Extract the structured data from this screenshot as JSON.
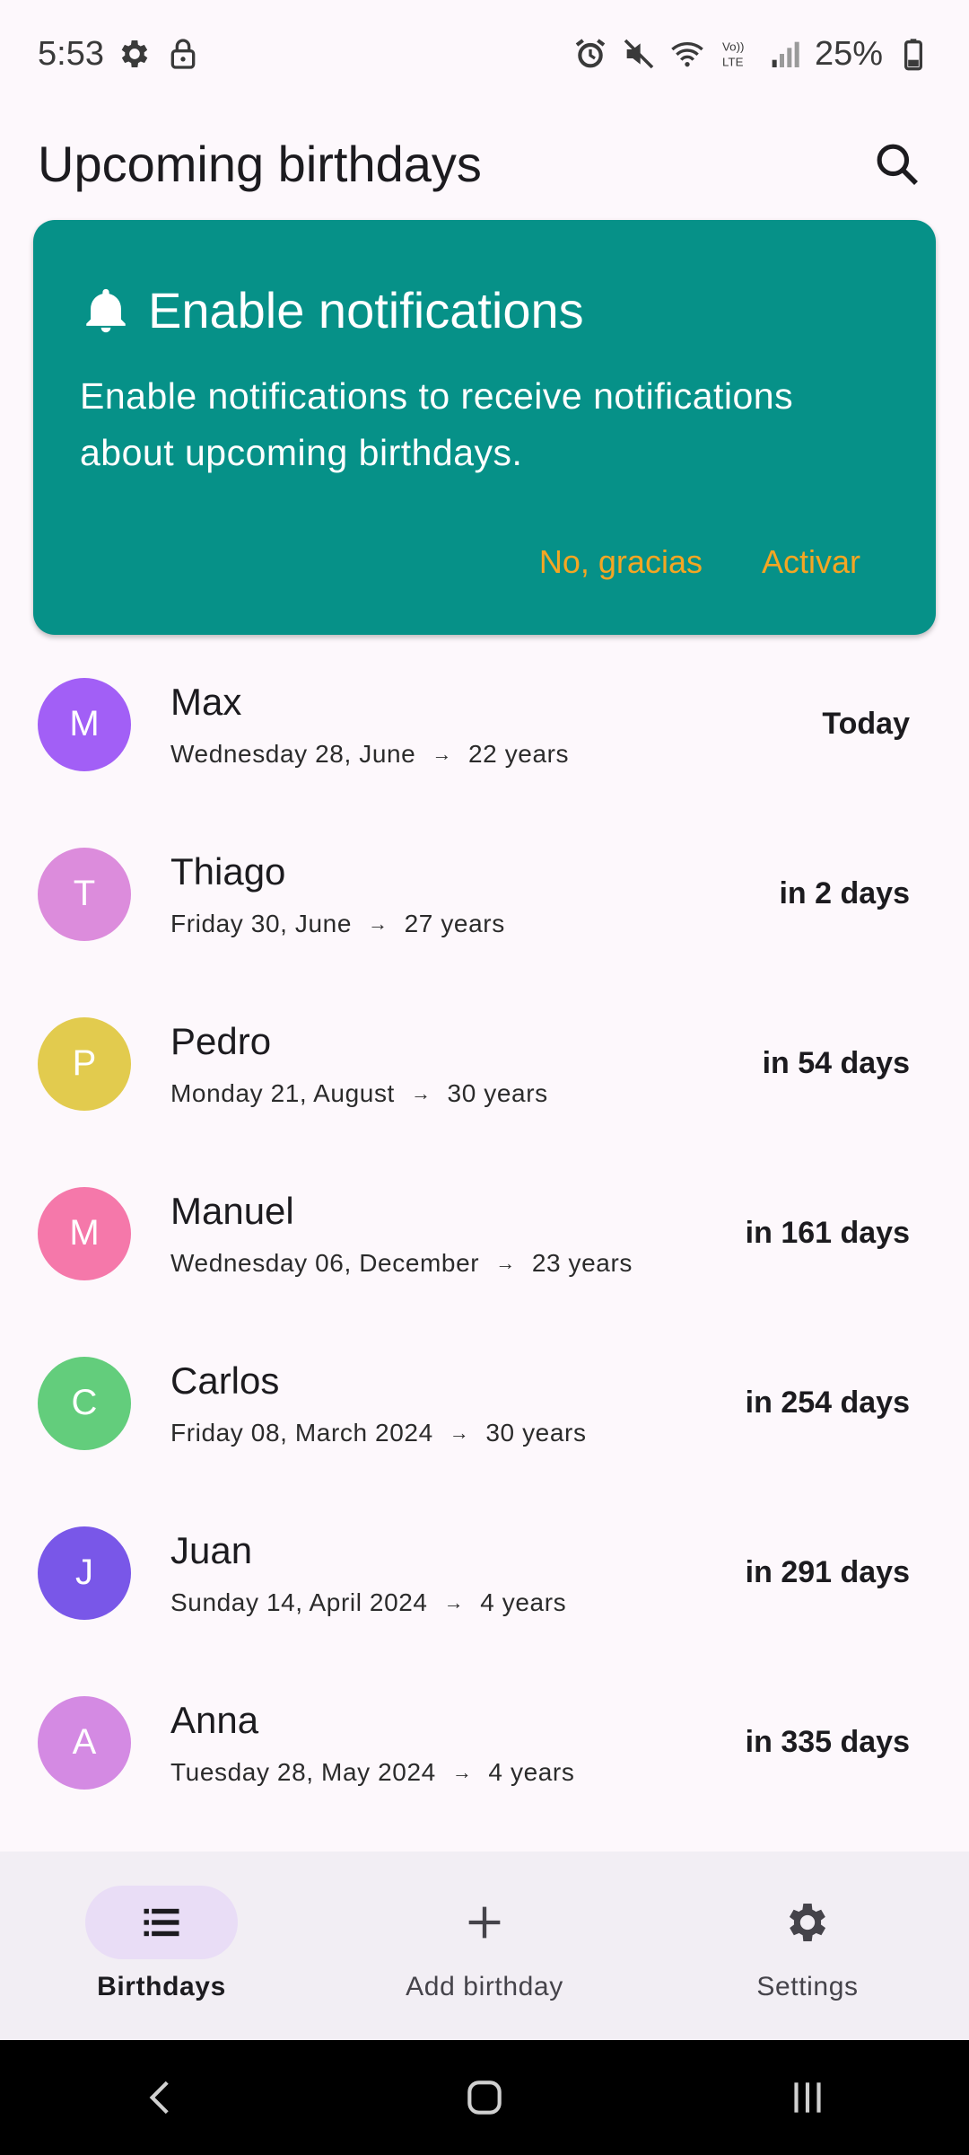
{
  "status_bar": {
    "time": "5:53",
    "battery": "25%",
    "left_icons": [
      "settings-gear-icon",
      "lock-icon"
    ],
    "right_icons": [
      "alarm-icon",
      "mute-icon",
      "wifi-icon",
      "volte-icon",
      "signal-icon",
      "battery-icon"
    ]
  },
  "header": {
    "title": "Upcoming birthdays",
    "search_icon": "search-icon"
  },
  "notification_card": {
    "icon": "bell-icon",
    "title": "Enable notifications",
    "body": "Enable notifications to receive notifications about upcoming birthdays.",
    "dismiss_label": "No, gracias",
    "enable_label": "Activar",
    "background": "#069188",
    "action_color": "#f4a623"
  },
  "birthdays": [
    {
      "initial": "M",
      "name": "Max",
      "date": "Wednesday 28, June",
      "age": "22 years",
      "when": "Today",
      "color": "#a25ff6"
    },
    {
      "initial": "T",
      "name": "Thiago",
      "date": "Friday 30, June",
      "age": "27 years",
      "when": "in 2 days",
      "color": "#dc8cdc"
    },
    {
      "initial": "P",
      "name": "Pedro",
      "date": "Monday 21, August",
      "age": "30 years",
      "when": "in 54 days",
      "color": "#e2cb4e"
    },
    {
      "initial": "M",
      "name": "Manuel",
      "date": "Wednesday 06, December",
      "age": "23 years",
      "when": "in 161 days",
      "color": "#f578aa"
    },
    {
      "initial": "C",
      "name": "Carlos",
      "date": "Friday 08, March 2024",
      "age": "30 years",
      "when": "in 254 days",
      "color": "#63cd7c"
    },
    {
      "initial": "J",
      "name": "Juan",
      "date": "Sunday 14, April 2024",
      "age": "4 years",
      "when": "in 291 days",
      "color": "#7957e8"
    },
    {
      "initial": "A",
      "name": "Anna",
      "date": "Tuesday 28, May 2024",
      "age": "4 years",
      "when": "in 335 days",
      "color": "#d48ae3"
    }
  ],
  "bottom_nav": {
    "items": [
      {
        "label": "Birthdays",
        "icon": "list-icon",
        "active": true
      },
      {
        "label": "Add birthday",
        "icon": "plus-icon",
        "active": false
      },
      {
        "label": "Settings",
        "icon": "gear-icon",
        "active": false
      }
    ]
  },
  "system_nav": [
    "back-icon",
    "home-icon",
    "recents-icon"
  ]
}
